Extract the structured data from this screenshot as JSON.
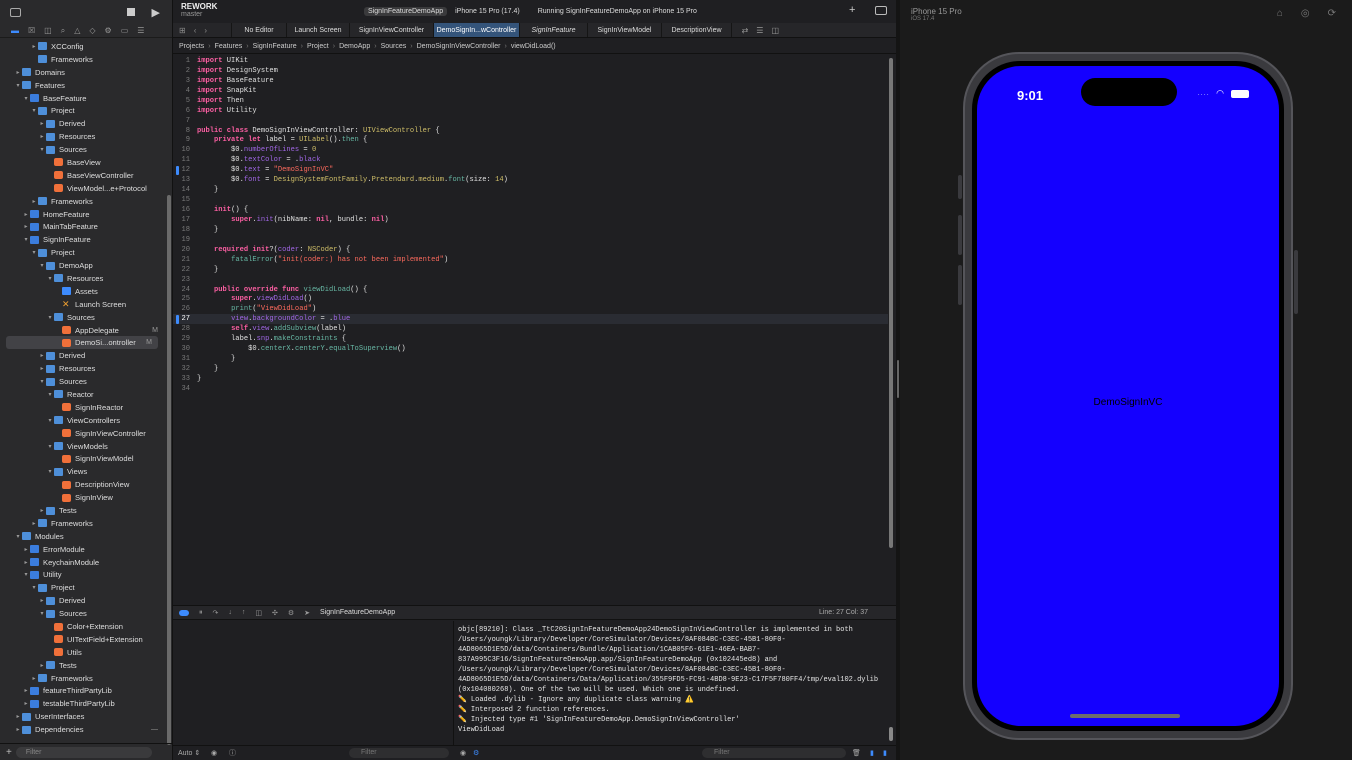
{
  "navigator": {
    "filter_placeholder": "Filter",
    "tree": [
      {
        "label": "XCConfig",
        "indent": 3,
        "chev": "▸",
        "icon": "folder"
      },
      {
        "label": "Frameworks",
        "indent": 3,
        "chev": "",
        "icon": "folder"
      },
      {
        "label": "Domains",
        "indent": 1,
        "chev": "▸",
        "icon": "folder"
      },
      {
        "label": "Features",
        "indent": 1,
        "chev": "▾",
        "icon": "folder"
      },
      {
        "label": "BaseFeature",
        "indent": 2,
        "chev": "▾",
        "icon": "blue"
      },
      {
        "label": "Project",
        "indent": 3,
        "chev": "▾",
        "icon": "folder"
      },
      {
        "label": "Derived",
        "indent": 4,
        "chev": "▸",
        "icon": "folder"
      },
      {
        "label": "Resources",
        "indent": 4,
        "chev": "▸",
        "icon": "folder"
      },
      {
        "label": "Sources",
        "indent": 4,
        "chev": "▾",
        "icon": "folder"
      },
      {
        "label": "BaseView",
        "indent": 5,
        "chev": "",
        "icon": "swift"
      },
      {
        "label": "BaseViewController",
        "indent": 5,
        "chev": "",
        "icon": "swift"
      },
      {
        "label": "ViewModel...e+Protocol",
        "indent": 5,
        "chev": "",
        "icon": "swift"
      },
      {
        "label": "Frameworks",
        "indent": 3,
        "chev": "▸",
        "icon": "folder"
      },
      {
        "label": "HomeFeature",
        "indent": 2,
        "chev": "▸",
        "icon": "blue"
      },
      {
        "label": "MainTabFeature",
        "indent": 2,
        "chev": "▸",
        "icon": "blue"
      },
      {
        "label": "SignInFeature",
        "indent": 2,
        "chev": "▾",
        "icon": "blue"
      },
      {
        "label": "Project",
        "indent": 3,
        "chev": "▾",
        "icon": "folder"
      },
      {
        "label": "DemoApp",
        "indent": 4,
        "chev": "▾",
        "icon": "folder"
      },
      {
        "label": "Resources",
        "indent": 5,
        "chev": "▾",
        "icon": "folder"
      },
      {
        "label": "Assets",
        "indent": 6,
        "chev": "",
        "icon": "asset"
      },
      {
        "label": "Launch Screen",
        "indent": 6,
        "chev": "",
        "icon": "storyboard"
      },
      {
        "label": "Sources",
        "indent": 5,
        "chev": "▾",
        "icon": "folder"
      },
      {
        "label": "AppDelegate",
        "indent": 6,
        "chev": "",
        "icon": "swift",
        "badge": "M"
      },
      {
        "label": "DemoSi...ontroller",
        "indent": 6,
        "chev": "",
        "icon": "swift",
        "badge": "M",
        "selected": true
      },
      {
        "label": "Derived",
        "indent": 4,
        "chev": "▸",
        "icon": "folder"
      },
      {
        "label": "Resources",
        "indent": 4,
        "chev": "▸",
        "icon": "folder"
      },
      {
        "label": "Sources",
        "indent": 4,
        "chev": "▾",
        "icon": "folder"
      },
      {
        "label": "Reactor",
        "indent": 5,
        "chev": "▾",
        "icon": "folder"
      },
      {
        "label": "SignInReactor",
        "indent": 6,
        "chev": "",
        "icon": "swift"
      },
      {
        "label": "ViewControllers",
        "indent": 5,
        "chev": "▾",
        "icon": "folder"
      },
      {
        "label": "SignInViewController",
        "indent": 6,
        "chev": "",
        "icon": "swift"
      },
      {
        "label": "ViewModels",
        "indent": 5,
        "chev": "▾",
        "icon": "folder"
      },
      {
        "label": "SignInViewModel",
        "indent": 6,
        "chev": "",
        "icon": "swift"
      },
      {
        "label": "Views",
        "indent": 5,
        "chev": "▾",
        "icon": "folder"
      },
      {
        "label": "DescriptionView",
        "indent": 6,
        "chev": "",
        "icon": "swift"
      },
      {
        "label": "SignInView",
        "indent": 6,
        "chev": "",
        "icon": "swift"
      },
      {
        "label": "Tests",
        "indent": 4,
        "chev": "▸",
        "icon": "folder"
      },
      {
        "label": "Frameworks",
        "indent": 3,
        "chev": "▸",
        "icon": "folder"
      },
      {
        "label": "Modules",
        "indent": 1,
        "chev": "▾",
        "icon": "folder"
      },
      {
        "label": "ErrorModule",
        "indent": 2,
        "chev": "▸",
        "icon": "blue"
      },
      {
        "label": "KeychainModule",
        "indent": 2,
        "chev": "▸",
        "icon": "blue"
      },
      {
        "label": "Utility",
        "indent": 2,
        "chev": "▾",
        "icon": "blue"
      },
      {
        "label": "Project",
        "indent": 3,
        "chev": "▾",
        "icon": "folder"
      },
      {
        "label": "Derived",
        "indent": 4,
        "chev": "▸",
        "icon": "folder"
      },
      {
        "label": "Sources",
        "indent": 4,
        "chev": "▾",
        "icon": "folder"
      },
      {
        "label": "Color+Extension",
        "indent": 5,
        "chev": "",
        "icon": "swift"
      },
      {
        "label": "UITextField+Extension",
        "indent": 5,
        "chev": "",
        "icon": "swift"
      },
      {
        "label": "Utils",
        "indent": 5,
        "chev": "",
        "icon": "swift"
      },
      {
        "label": "Tests",
        "indent": 4,
        "chev": "▸",
        "icon": "folder"
      },
      {
        "label": "Frameworks",
        "indent": 3,
        "chev": "▸",
        "icon": "folder"
      },
      {
        "label": "featureThirdPartyLib",
        "indent": 2,
        "chev": "▸",
        "icon": "blue"
      },
      {
        "label": "testableThirdPartyLib",
        "indent": 2,
        "chev": "▸",
        "icon": "blue"
      },
      {
        "label": "UserInterfaces",
        "indent": 1,
        "chev": "▸",
        "icon": "folder"
      },
      {
        "label": "Dependencies",
        "indent": 1,
        "chev": "▸",
        "icon": "folder",
        "trailing": "—"
      }
    ]
  },
  "window": {
    "project_name": "REWORK",
    "branch": "master",
    "scheme": "SignInFeatureDemoApp",
    "device": "iPhone 15 Pro (17.4)",
    "run_status": "Running SignInFeatureDemoApp on iPhone 15 Pro"
  },
  "tabs": [
    {
      "label": "No Editor",
      "width": 55
    },
    {
      "label": "Launch Screen",
      "width": 63
    },
    {
      "label": "SignInViewController",
      "width": 84
    },
    {
      "label": "DemoSignIn...wController",
      "width": 86,
      "active": true
    },
    {
      "label": "SignInFeature",
      "width": 68,
      "italic": true
    },
    {
      "label": "SignInViewModel",
      "width": 74
    },
    {
      "label": "DescriptionView",
      "width": 70
    }
  ],
  "jumpbar": [
    "Projects",
    "Features",
    "SignInFeature",
    "Project",
    "DemoApp",
    "Sources",
    "DemoSignInViewController",
    "viewDidLoad()"
  ],
  "code_lines": [
    [
      [
        "kw",
        "import"
      ],
      [
        "tx",
        " UIKit"
      ]
    ],
    [
      [
        "kw",
        "import"
      ],
      [
        "tx",
        " DesignSystem"
      ]
    ],
    [
      [
        "kw",
        "import"
      ],
      [
        "tx",
        " BaseFeature"
      ]
    ],
    [
      [
        "kw",
        "import"
      ],
      [
        "tx",
        " SnapKit"
      ]
    ],
    [
      [
        "kw",
        "import"
      ],
      [
        "tx",
        " Then"
      ]
    ],
    [
      [
        "kw",
        "import"
      ],
      [
        "tx",
        " Utility"
      ]
    ],
    [],
    [
      [
        "kw",
        "public class"
      ],
      [
        "tx",
        " DemoSignInViewController: "
      ],
      [
        "ty",
        "UIViewController"
      ],
      [
        "tx",
        " {"
      ]
    ],
    [
      [
        "tx",
        "    "
      ],
      [
        "kw",
        "private let"
      ],
      [
        "tx",
        " label = "
      ],
      [
        "ty",
        "UILabel"
      ],
      [
        "tx",
        "()."
      ],
      [
        "fn",
        "then"
      ],
      [
        "tx",
        " {"
      ]
    ],
    [
      [
        "tx",
        "        $0."
      ],
      [
        "pr",
        "numberOfLines"
      ],
      [
        "tx",
        " = "
      ],
      [
        "num",
        "0"
      ]
    ],
    [
      [
        "tx",
        "        $0."
      ],
      [
        "pr",
        "textColor"
      ],
      [
        "tx",
        " = ."
      ],
      [
        "pr",
        "black"
      ]
    ],
    [
      [
        "tx",
        "        $0."
      ],
      [
        "pr",
        "text"
      ],
      [
        "tx",
        " = "
      ],
      [
        "str",
        "\"DemoSignInVC\""
      ]
    ],
    [
      [
        "tx",
        "        $0."
      ],
      [
        "pr",
        "font"
      ],
      [
        "tx",
        " = "
      ],
      [
        "ty",
        "DesignSystemFontFamily"
      ],
      [
        "tx",
        "."
      ],
      [
        "ty",
        "Pretendard"
      ],
      [
        "tx",
        "."
      ],
      [
        "ty",
        "medium"
      ],
      [
        "tx",
        "."
      ],
      [
        "fn",
        "font"
      ],
      [
        "tx",
        "(size: "
      ],
      [
        "num",
        "14"
      ],
      [
        "tx",
        ")"
      ]
    ],
    [
      [
        "tx",
        "    }"
      ]
    ],
    [],
    [
      [
        "tx",
        "    "
      ],
      [
        "kw",
        "init"
      ],
      [
        "tx",
        "() {"
      ]
    ],
    [
      [
        "tx",
        "        "
      ],
      [
        "kw",
        "super"
      ],
      [
        "tx",
        "."
      ],
      [
        "pr",
        "init"
      ],
      [
        "tx",
        "(nibName: "
      ],
      [
        "kw",
        "nil"
      ],
      [
        "tx",
        ", bundle: "
      ],
      [
        "kw",
        "nil"
      ],
      [
        "tx",
        ")"
      ]
    ],
    [
      [
        "tx",
        "    }"
      ]
    ],
    [],
    [
      [
        "tx",
        "    "
      ],
      [
        "kw",
        "required init"
      ],
      [
        "tx",
        "?("
      ],
      [
        "pr",
        "coder"
      ],
      [
        "tx",
        ": "
      ],
      [
        "ty",
        "NSCoder"
      ],
      [
        "tx",
        ") {"
      ]
    ],
    [
      [
        "tx",
        "        "
      ],
      [
        "fn",
        "fatalError"
      ],
      [
        "tx",
        "("
      ],
      [
        "str",
        "\"init(coder:) has not been implemented\""
      ],
      [
        "tx",
        ")"
      ]
    ],
    [
      [
        "tx",
        "    }"
      ]
    ],
    [],
    [
      [
        "tx",
        "    "
      ],
      [
        "kw",
        "public override func"
      ],
      [
        "tx",
        " "
      ],
      [
        "fn",
        "viewDidLoad"
      ],
      [
        "tx",
        "() {"
      ]
    ],
    [
      [
        "tx",
        "        "
      ],
      [
        "kw",
        "super"
      ],
      [
        "tx",
        "."
      ],
      [
        "pr",
        "viewDidLoad"
      ],
      [
        "tx",
        "()"
      ]
    ],
    [
      [
        "tx",
        "        "
      ],
      [
        "fn",
        "print"
      ],
      [
        "tx",
        "("
      ],
      [
        "str",
        "\"ViewDidLoad\""
      ],
      [
        "tx",
        ")"
      ]
    ],
    [
      [
        "tx",
        "        "
      ],
      [
        "pr",
        "view"
      ],
      [
        "tx",
        "."
      ],
      [
        "pr",
        "backgroundColor"
      ],
      [
        "tx",
        " = ."
      ],
      [
        "pr",
        "blue"
      ]
    ],
    [
      [
        "tx",
        "        "
      ],
      [
        "kw",
        "self"
      ],
      [
        "tx",
        "."
      ],
      [
        "pr",
        "view"
      ],
      [
        "tx",
        "."
      ],
      [
        "fn",
        "addSubview"
      ],
      [
        "tx",
        "(label)"
      ]
    ],
    [
      [
        "tx",
        "        label."
      ],
      [
        "pr",
        "snp"
      ],
      [
        "tx",
        "."
      ],
      [
        "fn",
        "makeConstraints"
      ],
      [
        "tx",
        " {"
      ]
    ],
    [
      [
        "tx",
        "            $0."
      ],
      [
        "fn",
        "centerX"
      ],
      [
        "tx",
        "."
      ],
      [
        "fn",
        "centerY"
      ],
      [
        "tx",
        "."
      ],
      [
        "fn",
        "equalToSuperview"
      ],
      [
        "tx",
        "()"
      ]
    ],
    [
      [
        "tx",
        "        }"
      ]
    ],
    [
      [
        "tx",
        "    }"
      ]
    ],
    [
      [
        "tx",
        "}"
      ]
    ],
    []
  ],
  "current_line": 27,
  "change_marks": [
    12,
    27
  ],
  "debug": {
    "target": "SignInFeatureDemoApp",
    "line_col": "Line: 27  Col: 37",
    "auto_label": "Auto ⇕",
    "filter_left": "Filter",
    "filter_right": "Filter",
    "console_text": "objc[89210]: Class _TtC20SignInFeatureDemoApp24DemoSignInViewController is implemented in both /Users/youngk/Library/Developer/CoreSimulator/Devices/8AF084BC-C3EC-45B1-80F0-4AD8065D1E5D/data/Containers/Bundle/Application/1CAB05F6-61E1-46EA-BAB7-837A995C3F16/SignInFeatureDemoApp.app/SignInFeatureDemoApp (0x102445ed8) and /Users/youngk/Library/Developer/CoreSimulator/Devices/8AF084BC-C3EC-45B1-80F0-4AD8065D1E5D/data/Containers/Data/Application/355F9FD5-FC91-4BD8-9E23-C17F5F780FF4/tmp/eval102.dylib (0x104080268). One of the two will be used. Which one is undefined.\n✏️ Loaded .dylib - Ignore any duplicate class warning ⚠️\n✏️ Interposed 2 function references.\n✏️ Injected type #1 'SignInFeatureDemoApp.DemoSignInViewController'\nViewDidLoad"
  },
  "simulator": {
    "device_name": "iPhone 15 Pro",
    "os": "iOS 17.4",
    "time": "9:01",
    "label": "DemoSignInVC",
    "screen_color": "#1400ff"
  }
}
